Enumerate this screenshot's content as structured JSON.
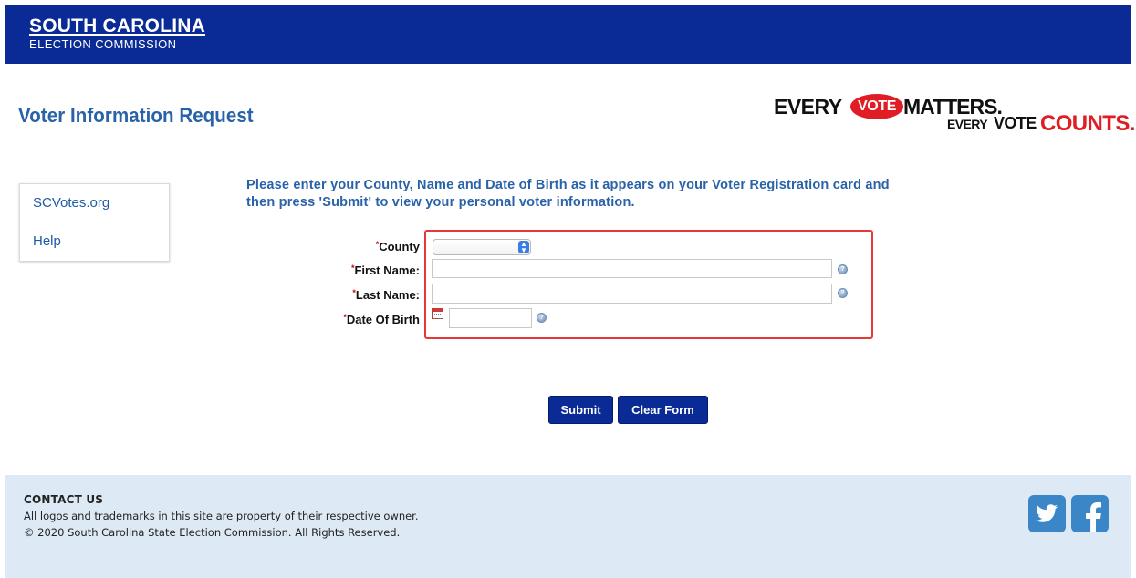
{
  "header": {
    "brand_line1": "SOUTH CAROLINA",
    "brand_line2": "ELECTION COMMISSION",
    "bar_color": "#0a2a96"
  },
  "page": {
    "title": "Voter Information Request"
  },
  "logo": {
    "every_1": "EVERY",
    "vote_1": "VOTE",
    "matters": "MATTERS.",
    "every_2": "EVERY",
    "vote_2": "VOTE",
    "counts": "COUNTS.",
    "accent_color": "#e01c24"
  },
  "sidebar": {
    "items": [
      {
        "label": "SCVotes.org"
      },
      {
        "label": "Help"
      }
    ]
  },
  "instructions": {
    "line1": "Please enter your County, Name and Date of Birth as it appears on your Voter Registration card and",
    "line2": "then press 'Submit' to view your personal voter information."
  },
  "form": {
    "required_mark": "*",
    "county_label": "County",
    "county_value": "",
    "first_name_label": "First Name:",
    "first_name_value": "",
    "last_name_label": "Last Name:",
    "last_name_value": "",
    "dob_label": "Date Of Birth",
    "dob_value": "",
    "highlight_color": "#e53935"
  },
  "buttons": {
    "submit": "Submit",
    "clear": "Clear Form"
  },
  "footer": {
    "heading": "CONTACT US",
    "line1": "All logos and trademarks in this site are property of their respective owner.",
    "line2": "© 2020 South Carolina State Election Commission. All Rights Reserved.",
    "background": "#dde9f5"
  },
  "icons": {
    "twitter": "twitter-icon",
    "facebook": "facebook-icon",
    "help": "help-icon",
    "calendar": "calendar-icon"
  }
}
